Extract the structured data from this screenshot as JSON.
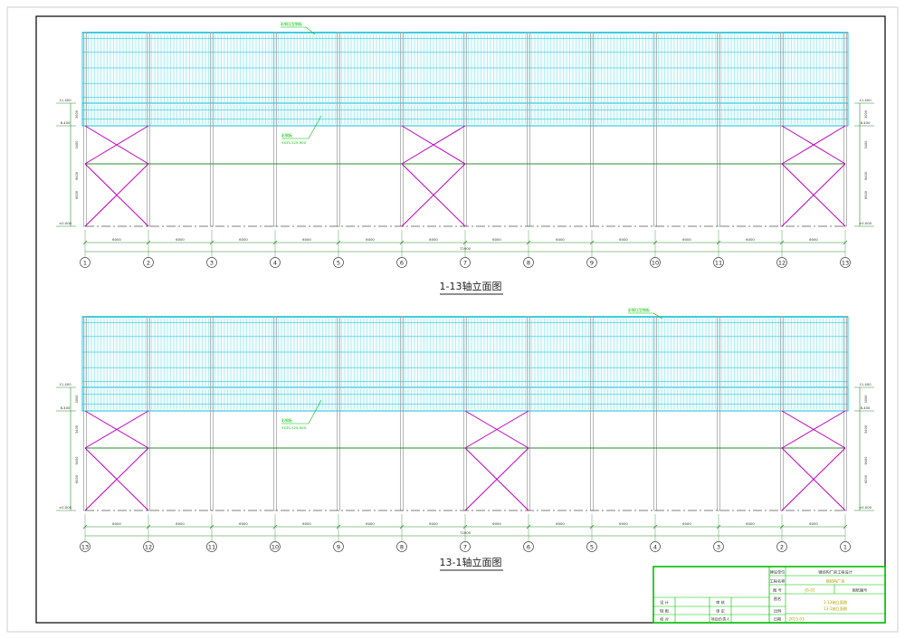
{
  "colors": {
    "frame": "#000000",
    "cladding": "#00bcd4",
    "cladding_light": "#7fdde8",
    "brace": "#c000c0",
    "grid": "#2e8b2e",
    "label": "#00c000",
    "dim": "#2a8a2a",
    "column": "#9a9a9a"
  },
  "views": [
    {
      "title": "1-13轴立面图",
      "axes": [
        "1",
        "2",
        "3",
        "4",
        "5",
        "6",
        "7",
        "8",
        "9",
        "10",
        "11",
        "12",
        "13"
      ],
      "braced_bays": [
        0,
        5,
        11
      ],
      "left_elevations": [
        "11.400",
        "8.400",
        "±0.000"
      ],
      "right_elevations": [
        "11.400",
        "8.400",
        "±0.000"
      ],
      "left_dims": [
        "3000",
        "3400",
        "9400",
        "6000"
      ],
      "right_dims": [
        "3000",
        "3400",
        "9400",
        "6000"
      ],
      "bay_dims": [
        "6000",
        "6000",
        "6000",
        "6000",
        "6000",
        "6000",
        "6000",
        "6000",
        "6000",
        "6000",
        "6000",
        "6000"
      ],
      "total_dim": "72000",
      "roof_label": "彩钢压型钢板",
      "wall_label": "彩钢板",
      "wall_label_sub": "YX35-125-900"
    },
    {
      "title": "13-1轴立面图",
      "axes": [
        "13",
        "12",
        "11",
        "10",
        "9",
        "8",
        "7",
        "6",
        "5",
        "4",
        "3",
        "2",
        "1"
      ],
      "braced_bays": [
        0,
        6,
        11
      ],
      "left_elevations": [
        "11.400",
        "8.400",
        "±0.000"
      ],
      "right_elevations": [
        "11.400",
        "8.400",
        "±0.000"
      ],
      "left_dims": [
        "3000",
        "3400",
        "9400",
        "6000"
      ],
      "right_dims": [
        "3000",
        "3400",
        "9400",
        "6000"
      ],
      "bay_dims": [
        "6000",
        "6000",
        "6000",
        "6000",
        "6000",
        "6000",
        "6000",
        "6000",
        "6000",
        "6000",
        "6000",
        "6000"
      ],
      "total_dim": "72000",
      "roof_label": "彩钢压型钢板",
      "wall_label": "彩钢板",
      "wall_label_sub": "YX35-125-900"
    }
  ],
  "title_block": {
    "r1_label": "建设单位",
    "r1_value": "钢结构厂房工程设计",
    "r2_label": "工程名称",
    "r2_value": "钢结构厂房",
    "r3_label": "图  号",
    "r3_value": "JG-01",
    "r3_extra": "图纸编号",
    "r4_left": "设 计",
    "r4_mid": "审 核",
    "r4_label": "图名",
    "r4_value": "1-13轴立面图",
    "r5_left": "制 图",
    "r5_mid": "审 定",
    "r5_label": "比例",
    "r5_value": "13-1轴立面图",
    "r6_left": "校 对",
    "r6_mid": "项目负责人",
    "r6_label": "日期",
    "r6_value": "2015.03"
  }
}
